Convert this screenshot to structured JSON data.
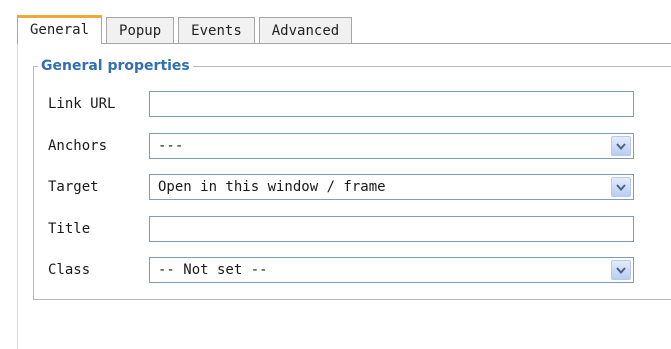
{
  "tabs": [
    {
      "label": "General",
      "active": true
    },
    {
      "label": "Popup",
      "active": false
    },
    {
      "label": "Events",
      "active": false
    },
    {
      "label": "Advanced",
      "active": false
    }
  ],
  "general": {
    "legend": "General properties",
    "link_url": {
      "label": "Link URL",
      "value": ""
    },
    "anchors": {
      "label": "Anchors",
      "selected": "---",
      "icon": "chevron-down-icon"
    },
    "target": {
      "label": "Target",
      "selected": "Open in this window / frame",
      "icon": "chevron-down-icon"
    },
    "title": {
      "label": "Title",
      "value": ""
    },
    "class": {
      "label": "Class",
      "selected": "-- Not set --",
      "icon": "chevron-down-icon"
    }
  },
  "colors": {
    "legend": "#2f6fb3",
    "active_tab_accent": "#f0a83a",
    "input_border": "#7f9db9"
  }
}
